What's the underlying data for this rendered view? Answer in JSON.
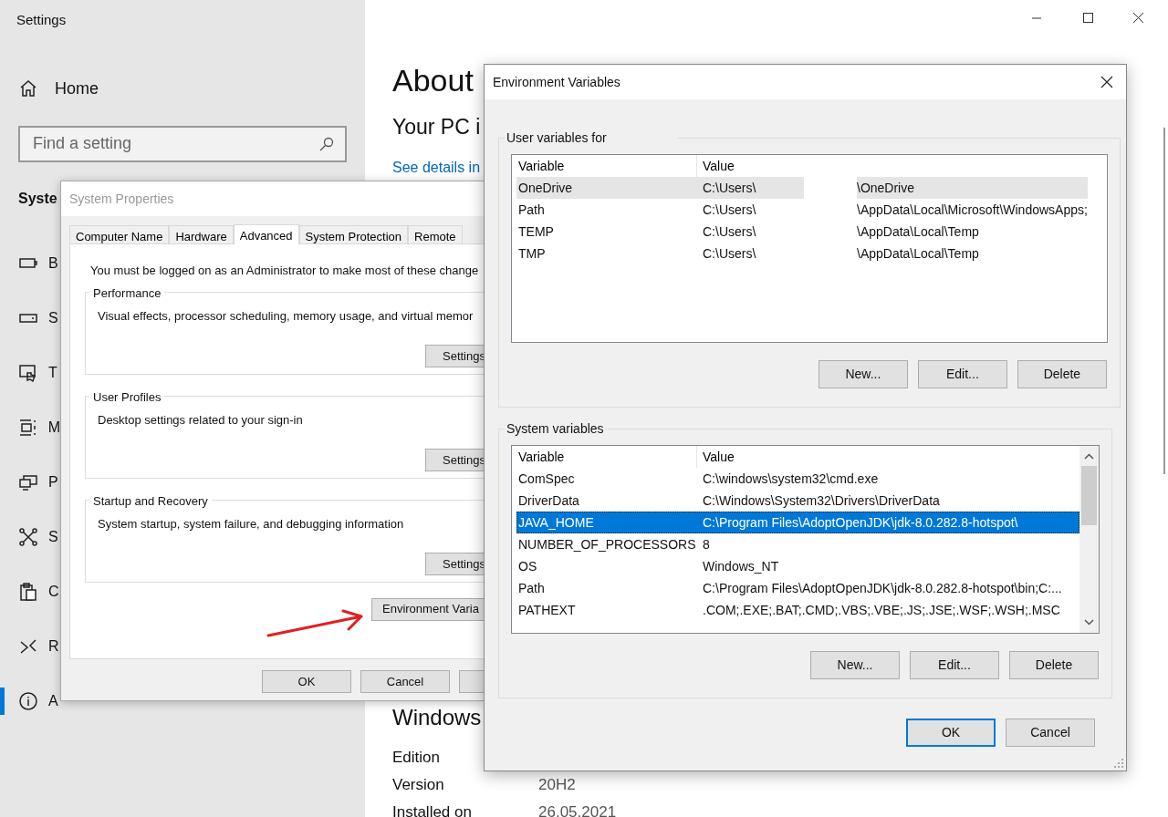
{
  "settings": {
    "title": "Settings",
    "home": "Home",
    "search": {
      "placeholder": "Find a setting"
    },
    "section": "Syste",
    "nav": [
      {
        "label": "B",
        "selected": false
      },
      {
        "label": "S",
        "selected": false
      },
      {
        "label": "T",
        "selected": false
      },
      {
        "label": "M",
        "selected": false
      },
      {
        "label": "P",
        "selected": false
      },
      {
        "label": "S",
        "selected": false
      },
      {
        "label": "C",
        "selected": false
      },
      {
        "label": "R",
        "selected": false
      },
      {
        "label": "A",
        "selected": true
      }
    ],
    "page": {
      "title": "About",
      "subtitle": "Your PC i",
      "link": "See details in",
      "section": "Windows",
      "specs": [
        {
          "label": "Edition"
        },
        {
          "label": "Version",
          "value": "20H2"
        },
        {
          "label": "Installed on",
          "value": "26.05.2021"
        }
      ]
    }
  },
  "system_properties": {
    "title": "System Properties",
    "tabs": [
      {
        "label": "Computer Name",
        "selected": false
      },
      {
        "label": "Hardware",
        "selected": false
      },
      {
        "label": "Advanced",
        "selected": true
      },
      {
        "label": "System Protection",
        "selected": false
      },
      {
        "label": "Remote",
        "selected": false
      }
    ],
    "notice": "You must be logged on as an Administrator to make most of these change",
    "groups": [
      {
        "title": "Performance",
        "description": "Visual effects, processor scheduling, memory usage, and virtual memor",
        "button": "Settings"
      },
      {
        "title": "User Profiles",
        "description": "Desktop settings related to your sign-in",
        "button": "Settings"
      },
      {
        "title": "Startup and Recovery",
        "description": "System startup, system failure, and debugging information",
        "button": "Settings"
      }
    ],
    "env_button": "Environment Varia",
    "buttons": [
      "OK",
      "Cancel"
    ]
  },
  "environment_variables": {
    "title": "Environment Variables",
    "user_group": {
      "title": "User variables for",
      "focused": false,
      "columns": [
        "Variable",
        "Value"
      ],
      "rows": [
        {
          "variable": "OneDrive",
          "value_parts": [
            "C:\\Users\\",
            "\\OneDrive"
          ],
          "selected": true
        },
        {
          "variable": "Path",
          "value_parts": [
            "C:\\Users\\",
            "\\AppData\\Local\\Microsoft\\WindowsApps;"
          ],
          "selected": false
        },
        {
          "variable": "TEMP",
          "value_parts": [
            "C:\\Users\\",
            "\\AppData\\Local\\Temp"
          ],
          "selected": false
        },
        {
          "variable": "TMP",
          "value_parts": [
            "C:\\Users\\",
            "\\AppData\\Local\\Temp"
          ],
          "selected": false
        }
      ],
      "buttons": [
        "New...",
        "Edit...",
        "Delete"
      ]
    },
    "system_group": {
      "title": "System variables",
      "focused": true,
      "columns": [
        "Variable",
        "Value"
      ],
      "rows": [
        {
          "variable": "ComSpec",
          "value_parts": [
            "C:\\windows\\system32\\cmd.exe"
          ],
          "selected": false
        },
        {
          "variable": "DriverData",
          "value_parts": [
            "C:\\Windows\\System32\\Drivers\\DriverData"
          ],
          "selected": false
        },
        {
          "variable": "JAVA_HOME",
          "value_parts": [
            "C:\\Program Files\\AdoptOpenJDK\\jdk-8.0.282.8-hotspot\\"
          ],
          "selected": true
        },
        {
          "variable": "NUMBER_OF_PROCESSORS",
          "value_parts": [
            "8"
          ],
          "selected": false
        },
        {
          "variable": "OS",
          "value_parts": [
            "Windows_NT"
          ],
          "selected": false
        },
        {
          "variable": "Path",
          "value_parts": [
            "C:\\Program Files\\AdoptOpenJDK\\jdk-8.0.282.8-hotspot\\bin;C:..."
          ],
          "selected": false
        },
        {
          "variable": "PATHEXT",
          "value_parts": [
            ".COM;.EXE;.BAT;.CMD;.VBS;.VBE;.JS;.JSE;.WSF;.WSH;.MSC"
          ],
          "selected": false
        }
      ],
      "buttons": [
        "New...",
        "Edit...",
        "Delete"
      ]
    },
    "buttons": [
      {
        "label": "OK",
        "default": true
      },
      {
        "label": "Cancel",
        "default": false
      }
    ]
  }
}
